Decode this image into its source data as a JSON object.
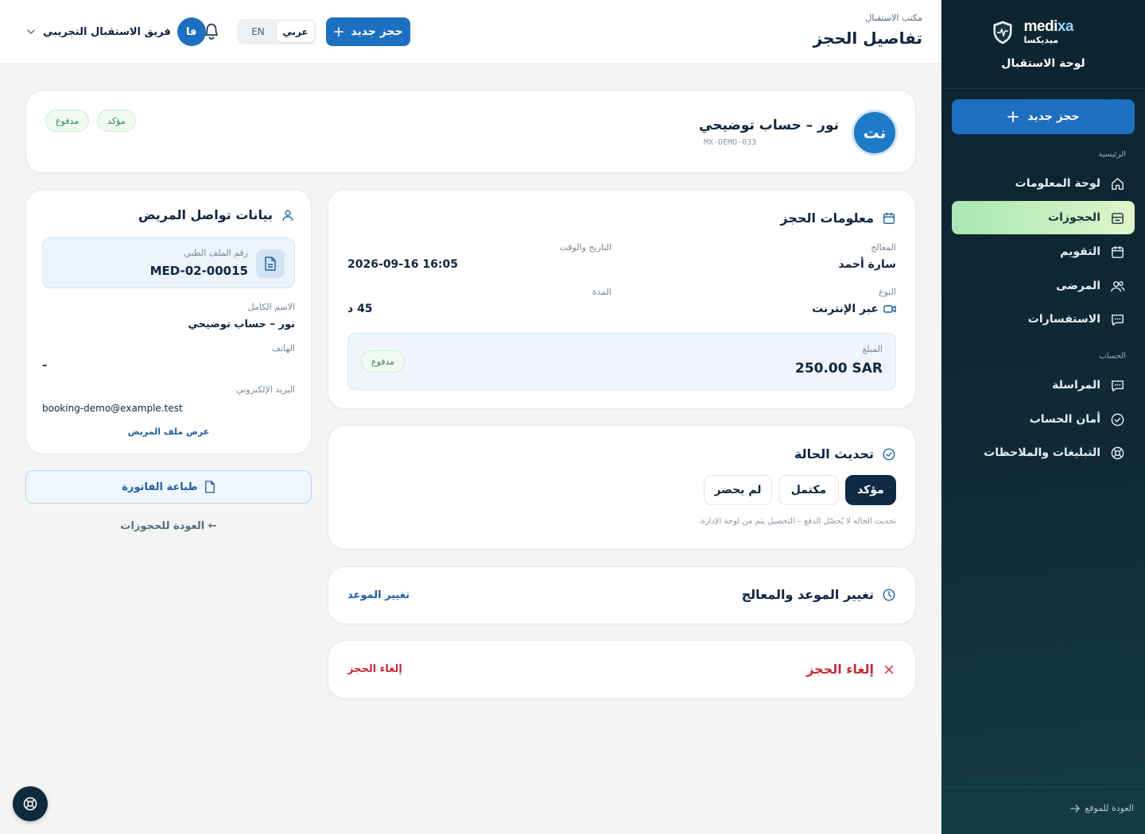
{
  "sidebar": {
    "brand_name_main": "medi",
    "brand_name_accent": "xa",
    "brand_name_ar": "ميديكسا",
    "subtitle": "لوحة الاستقبال",
    "new_booking": "حجز جديد",
    "section_main": "الرئيسية",
    "section_account": "الحساب",
    "items": [
      {
        "label": "لوحة المعلومات",
        "icon": "home-icon"
      },
      {
        "label": "الحجوزات",
        "icon": "bookings-icon"
      },
      {
        "label": "التقويم",
        "icon": "calendar-icon"
      },
      {
        "label": "المرضى",
        "icon": "users-icon"
      },
      {
        "label": "الاستفسارات",
        "icon": "chat-icon"
      },
      {
        "label": "المراسلة",
        "icon": "message-icon"
      },
      {
        "label": "أمان الحساب",
        "icon": "shield-check-icon"
      },
      {
        "label": "التبليغات والملاحظات",
        "icon": "lifebuoy-icon"
      }
    ],
    "back_to_site": "العودة للموقع"
  },
  "header": {
    "breadcrumb": "مكتب الاستقبال",
    "title": "تفاصيل الحجز",
    "new_booking": "حجز جديد",
    "lang_ar": "عربي",
    "lang_en": "EN",
    "user_initials": "فا",
    "user_name": "فريق الاستقبال التجريبي"
  },
  "patient": {
    "initials": "نت",
    "name": "نور – حساب توضيحي",
    "id": "MX-DEMO-033",
    "badge_confirmed": "مؤكد",
    "badge_paid": "مدفوع"
  },
  "booking": {
    "title": "معلومات الحجز",
    "provider_label": "المعالج",
    "provider": "سارة أحمد",
    "datetime_label": "التاريخ والوقت",
    "datetime": "2026-09-16 16:05",
    "type_label": "النوع",
    "type": "عبر الإنترنت",
    "duration_label": "المدة",
    "duration": "45 د",
    "amount_label": "المبلغ",
    "amount": "250.00 SAR",
    "amount_badge": "مدفوع"
  },
  "status": {
    "title": "تحديث الحالة",
    "options": [
      "مؤكد",
      "مكتمل",
      "لم يحضر"
    ],
    "note": "تحديث الحالة لا يُحصّل الدفع – التحصيل يتم من لوحة الإدارة."
  },
  "reschedule": {
    "title": "تغيير الموعد والمعالج",
    "action": "تغيير الموعد"
  },
  "cancel": {
    "title": "إلغاء الحجز",
    "action": "إلغاء الحجز"
  },
  "contact": {
    "title": "بيانات تواصل المريض",
    "med_label": "رقم الملف الطبي",
    "med_value": "MED-02-00015",
    "name_label": "الاسم الكامل",
    "name_value": "نور – حساب توضيحي",
    "phone_label": "الهاتف",
    "phone_value": "–",
    "email_label": "البريد الإلكتروني",
    "email_value": "booking-demo@example.test",
    "view_profile": "عرض ملف المريض"
  },
  "actions": {
    "print_invoice": "طباعة الفاتورة",
    "back_to_bookings": "← العودة للحجوزات"
  },
  "colors": {
    "primary": "#1d6fc0",
    "sidebar": "#0e2330",
    "active_item": "#a8e6b4",
    "success": "#2f8a4e",
    "danger": "#c42b3b"
  }
}
